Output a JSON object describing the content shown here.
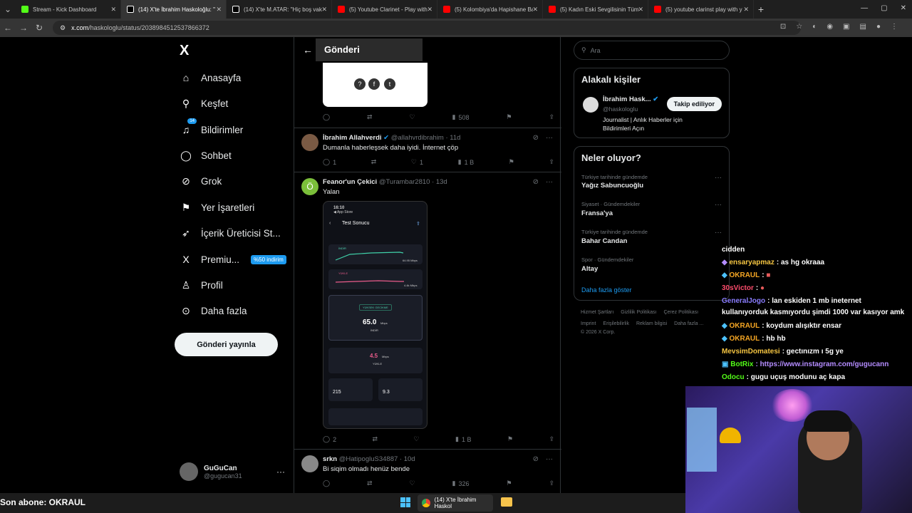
{
  "browser": {
    "tabs": [
      {
        "title": "Stream - Kick Dashboard",
        "color": "#53fc18"
      },
      {
        "title": "(14) X'te İbrahim Haskoloğlu: \"",
        "color": "#ffffff"
      },
      {
        "title": "(14) X'te M.ATAR: \"Hiç boş vakt",
        "color": "#ffffff"
      },
      {
        "title": "(5) Youtube Clarinet - Play with",
        "color": "#ff0000"
      },
      {
        "title": "(5) Kolombiya'da Hapishane Ba",
        "color": "#ff0000"
      },
      {
        "title": "(5) Kadın Eski Sevgilisinin Tüm",
        "color": "#ff0000"
      },
      {
        "title": "(5) youtube clarinst play with y",
        "color": "#ff0000"
      }
    ],
    "url_host": "x.com",
    "url_path": "/haskologlu/status/2038984512537866372"
  },
  "nav": {
    "logo": "X",
    "items": [
      {
        "label": "Anasayfa",
        "icon": "home-icon"
      },
      {
        "label": "Keşfet",
        "icon": "search-icon"
      },
      {
        "label": "Bildirimler",
        "icon": "bell-icon",
        "badge": "14"
      },
      {
        "label": "Sohbet",
        "icon": "chat-icon"
      },
      {
        "label": "Grok",
        "icon": "grok-icon"
      },
      {
        "label": "Yer İşaretleri",
        "icon": "bookmark-icon"
      },
      {
        "label": "İçerik Üreticisi St...",
        "icon": "rocket-icon"
      },
      {
        "label": "Premiu...",
        "icon": "x-premium-icon",
        "promo": "%50 indirim"
      },
      {
        "label": "Profil",
        "icon": "person-icon"
      },
      {
        "label": "Daha fazla",
        "icon": "more-circle-icon"
      }
    ],
    "post_button": "Gönderi yayınla",
    "account": {
      "name": "GuGuCan",
      "handle": "@gugucan31"
    }
  },
  "feed": {
    "header_title": "Gönderi",
    "first_actions": {
      "views": "508"
    },
    "tweets": [
      {
        "name": "İbrahim Allahverdi",
        "handle": "@allahvrdibrahim",
        "time": "· 11d",
        "text": "Dumanla haberleşsek daha iyidi. İnternet çöp",
        "replies": "1",
        "likes": "1",
        "views": "1 B"
      },
      {
        "name": "Feanor'un Çekici",
        "handle": "@Turambar2810",
        "time": "· 13d",
        "text": "Yalan",
        "replies": "2",
        "views": "1 B",
        "image": {
          "time": "16:10",
          "app": "◀ App Store",
          "title": "Test Sonucu",
          "label1": "İNDİR",
          "label2": "YÜKLE",
          "mbps1": "64.95 Mbps",
          "mbps2": "4.4k Mbps",
          "status": "YÜKSEK GECİKME",
          "main_value": "65.0",
          "main_unit": "Mbps",
          "main_sub": "İNDİR",
          "up_value": "4.5",
          "up_unit": "Mbps",
          "up_sub": "YÜKLE",
          "ping": "215",
          "jitter": "9.3"
        }
      },
      {
        "name": "srkn",
        "handle": "@HatipogluS34887",
        "time": "· 10d",
        "text": "Bi siqim olmadı henüz bende",
        "views": "326"
      }
    ]
  },
  "right": {
    "search_placeholder": "Ara",
    "people_title": "Alakalı kişiler",
    "person": {
      "name": "İbrahim Hask...",
      "handle": "@haskologlu",
      "bio": "Journalist | Anlık Haberler için Bildirimleri Açın",
      "follow_label": "Takip ediliyor"
    },
    "trends_title": "Neler oluyor?",
    "trends": [
      {
        "category": "Türkiye tarihinde gündemde",
        "name": "Yağız Sabuncuoğlu"
      },
      {
        "category": "Siyaset · Gündemdekiler",
        "name": "Fransa'ya"
      },
      {
        "category": "Türkiye tarihinde gündemde",
        "name": "Bahar Candan"
      },
      {
        "category": "Spor · Gündemdekiler",
        "name": "Altay"
      }
    ],
    "show_more": "Daha fazla göster",
    "footer1": [
      "Hizmet Şartları",
      "Gizlilik Politikası",
      "Çerez Politikası"
    ],
    "footer2": [
      "Imprint",
      "Erişilebilirlik",
      "Reklam bilgisi",
      "Daha fazla ..."
    ],
    "copyright": "© 2026 X Corp."
  },
  "chat": {
    "lines": [
      {
        "user": "",
        "msg": "cidden",
        "color": "#ffffff"
      },
      {
        "user": "ensaryapmaz",
        "msg": ": as hg okraaa",
        "color": "#f5c542"
      },
      {
        "user": "OKRAUL",
        "msg": ":",
        "color": "#f5a623"
      },
      {
        "user": "30sVictor",
        "msg": ":",
        "color": "#ff4d6d"
      },
      {
        "user": "GeneralJogo",
        "msg": ": lan eskiden 1 mb ineternet",
        "color": "#8a7dff"
      },
      {
        "user": "",
        "msg": "kullanıyorduk kasmıyordu şimdi 1000 var kasıyor amk",
        "color": "#ffffff"
      },
      {
        "user": "OKRAUL",
        "msg": ": koydum alışıktır ensar",
        "color": "#f5a623"
      },
      {
        "user": "OKRAUL",
        "msg": ": hb hb",
        "color": "#f5a623"
      },
      {
        "user": "MevsimDomatesi",
        "msg": ": gectınızm ı 5g ye",
        "color": "#f5c542"
      },
      {
        "user": "BotRix",
        "msg": ": https://www.instagram.com/gugucann",
        "color": "#53fc18"
      },
      {
        "user": "Odocu",
        "msg": ": gugu uçuş modunu aç kapa",
        "color": "#53fc18"
      }
    ],
    "link_color": "#b48cff"
  },
  "taskbar": {
    "last_sub": "Son abone: OKRAUL",
    "app_title": "(14) X'te İbrahim Haskol"
  }
}
